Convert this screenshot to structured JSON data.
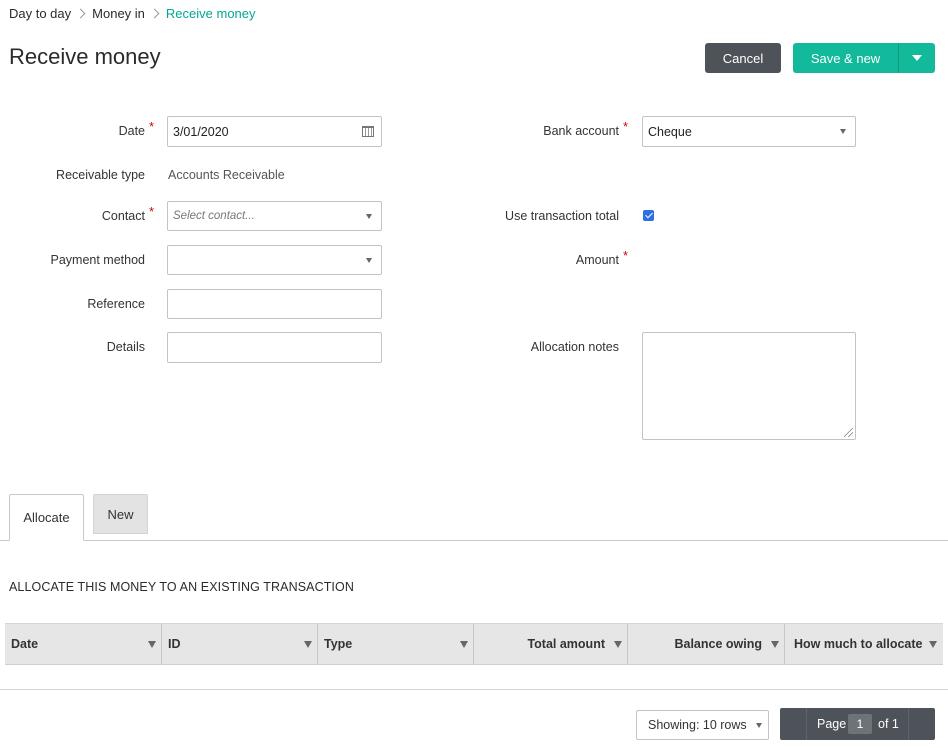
{
  "breadcrumb": {
    "items": [
      "Day to day",
      "Money in"
    ],
    "current": "Receive money"
  },
  "page": {
    "title": "Receive money",
    "cancel_label": "Cancel",
    "save_label": "Save & new"
  },
  "form": {
    "date": {
      "label": "Date",
      "value": "3/01/2020"
    },
    "receivable_type": {
      "label": "Receivable type",
      "value": "Accounts Receivable"
    },
    "contact": {
      "label": "Contact",
      "placeholder": "Select contact..."
    },
    "payment_method": {
      "label": "Payment method",
      "value": ""
    },
    "reference": {
      "label": "Reference",
      "value": ""
    },
    "details": {
      "label": "Details",
      "value": ""
    },
    "bank_account": {
      "label": "Bank account",
      "value": "Cheque"
    },
    "use_transaction_total": {
      "label": "Use transaction total",
      "checked": true
    },
    "amount": {
      "label": "Amount"
    },
    "allocation_notes": {
      "label": "Allocation notes",
      "value": ""
    },
    "required_mark": "*"
  },
  "tabs": [
    {
      "label": "Allocate",
      "active": true
    },
    {
      "label": "New",
      "active": false
    }
  ],
  "allocate": {
    "section_title": "ALLOCATE THIS MONEY TO AN EXISTING TRANSACTION",
    "columns": [
      "Date",
      "ID",
      "Type",
      "Total amount",
      "Balance owing",
      "How much to allocate"
    ],
    "rows": []
  },
  "footer": {
    "showing": "Showing: 10 rows",
    "page_label": "Page",
    "page_number": "1",
    "of_label": "of 1"
  },
  "colors": {
    "accent": "#12b99a",
    "breadcrumb_current": "#00a98f",
    "dark_button": "#4d5359",
    "required": "#d0021b",
    "checkbox": "#2f6fe4"
  }
}
